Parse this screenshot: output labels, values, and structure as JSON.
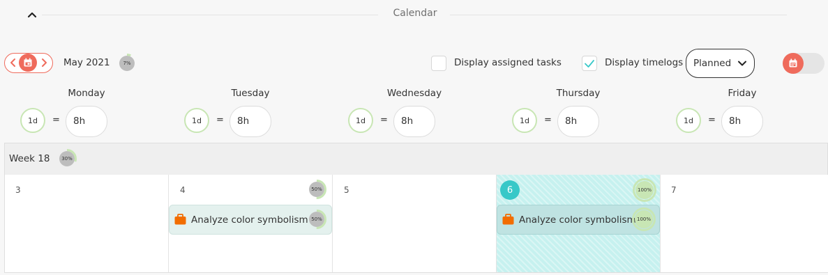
{
  "header": {
    "title": "Calendar",
    "collapse_icon": "chevron-up-icon"
  },
  "toolbar": {
    "month": "May 2021",
    "month_progress": "7%",
    "month_progress_value": 0.07,
    "assigned_label": "Display assigned tasks",
    "assigned_checked": false,
    "timelogs_label": "Display timelogs",
    "timelogs_checked": true,
    "mode_value": "Planned",
    "toggle_on": false
  },
  "colors": {
    "accent": "#ef6b5c",
    "today": "#37c8c8",
    "progress": "#c8e6b4",
    "task_icon": "#f26d00"
  },
  "days": [
    {
      "name": "Monday",
      "duration": "1d",
      "eq": "=",
      "hours": "8h"
    },
    {
      "name": "Tuesday",
      "duration": "1d",
      "eq": "=",
      "hours": "8h"
    },
    {
      "name": "Wednesday",
      "duration": "1d",
      "eq": "=",
      "hours": "8h"
    },
    {
      "name": "Thursday",
      "duration": "1d",
      "eq": "=",
      "hours": "8h"
    },
    {
      "name": "Friday",
      "duration": "1d",
      "eq": "=",
      "hours": "8h"
    }
  ],
  "week": {
    "label": "Week 18",
    "progress": "30%",
    "progress_value": 0.3
  },
  "cells": [
    {
      "date": "3"
    },
    {
      "date": "4",
      "progress": "50%",
      "progress_value": 0.5
    },
    {
      "date": "5"
    },
    {
      "date": "6",
      "progress": "100%",
      "progress_value": 1.0,
      "today": true
    },
    {
      "date": "7"
    }
  ],
  "tasks": [
    {
      "name": "Analyze color symbolism",
      "progress": "50%",
      "progress_value": 0.5,
      "icon": "briefcase-icon"
    },
    {
      "name": "Analyze color symbolism",
      "progress": "100%",
      "progress_value": 1.0,
      "icon": "briefcase-icon"
    }
  ]
}
